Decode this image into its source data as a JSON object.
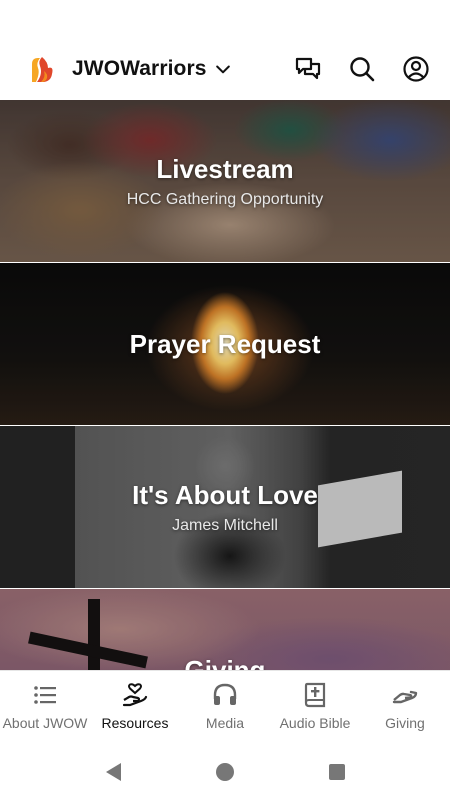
{
  "header": {
    "org_name": "JWOWarriors"
  },
  "cards": [
    {
      "title": "Livestream",
      "subtitle": "HCC Gathering Opportunity"
    },
    {
      "title": "Prayer Request",
      "subtitle": ""
    },
    {
      "title": "It's About Love",
      "subtitle": "James Mitchell"
    },
    {
      "title": "Giving",
      "subtitle": ""
    }
  ],
  "bottom_nav": [
    {
      "label": "About JWOW",
      "icon": "list-icon",
      "active": false
    },
    {
      "label": "Resources",
      "icon": "hand-heart-icon",
      "active": true
    },
    {
      "label": "Media",
      "icon": "headphones-icon",
      "active": false
    },
    {
      "label": "Audio Bible",
      "icon": "bible-icon",
      "active": false
    },
    {
      "label": "Giving",
      "icon": "giving-hand-icon",
      "active": false
    }
  ],
  "colors": {
    "active": "#111111",
    "inactive": "#707070",
    "logo_orange": "#f28a1e",
    "logo_red": "#e0472b"
  }
}
